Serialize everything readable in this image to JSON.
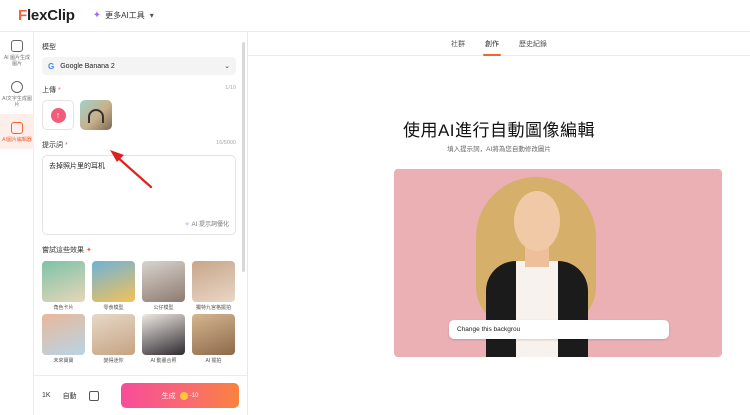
{
  "app": {
    "logo_prefix": "F",
    "logo_rest": "lexClip",
    "ai_menu_label": "更多AI工具"
  },
  "rail": {
    "items": [
      {
        "label": "AI 圖片生成圖片",
        "icon": "images-icon",
        "active": false
      },
      {
        "label": "AI文字生成圖片",
        "icon": "text-image-icon",
        "active": false
      },
      {
        "label": "AI圖片編輯器",
        "icon": "edit-image-icon",
        "active": true
      }
    ]
  },
  "panel": {
    "model_label": "模型",
    "model_value": "Google Banana 2",
    "upload_label": "上傳",
    "upload_required": "*",
    "upload_count": "1/10",
    "prompt_label": "提示詞",
    "prompt_required": "*",
    "prompt_count": "16/5000",
    "prompt_text": "去掉照片里的耳机",
    "prompt_optimize_label": "AI 提示詞優化",
    "effects_label": "嘗試這些效果",
    "effects": [
      {
        "caption": "角色卡片",
        "colors": [
          "#7cc3a8",
          "#e8d6b8"
        ]
      },
      {
        "caption": "零食模型",
        "colors": [
          "#6db3d8",
          "#f4c15a"
        ]
      },
      {
        "caption": "公仔模型",
        "colors": [
          "#d9d4cf",
          "#8e7a6e"
        ]
      },
      {
        "caption": "獨特九宮格擺拍",
        "colors": [
          "#c8a58a",
          "#e9d7c6"
        ]
      },
      {
        "caption": "未來寶寶",
        "colors": [
          "#e9b89a",
          "#b8d4e6"
        ]
      },
      {
        "caption": "變得迷你",
        "colors": [
          "#e6d9c7",
          "#c6a383"
        ]
      },
      {
        "caption": "AI 動畫合照",
        "colors": [
          "#efe9e4",
          "#2f2a30"
        ]
      },
      {
        "caption": "AI 擺拍",
        "colors": [
          "#d6b690",
          "#8c6a4a"
        ]
      }
    ],
    "bottom": {
      "resolution": "1K",
      "mode": "自動",
      "generate_label": "生成",
      "cost": "-10"
    }
  },
  "main": {
    "tabs": [
      {
        "label": "社群",
        "active": false
      },
      {
        "label": "創作",
        "active": true
      },
      {
        "label": "歷史紀錄",
        "active": false
      }
    ],
    "title": "使用AI進行自動圖像編輯",
    "subtitle": "填入提示詞，AI將為您自動修改圖片",
    "preview_prompt": "Change this backgrou"
  }
}
